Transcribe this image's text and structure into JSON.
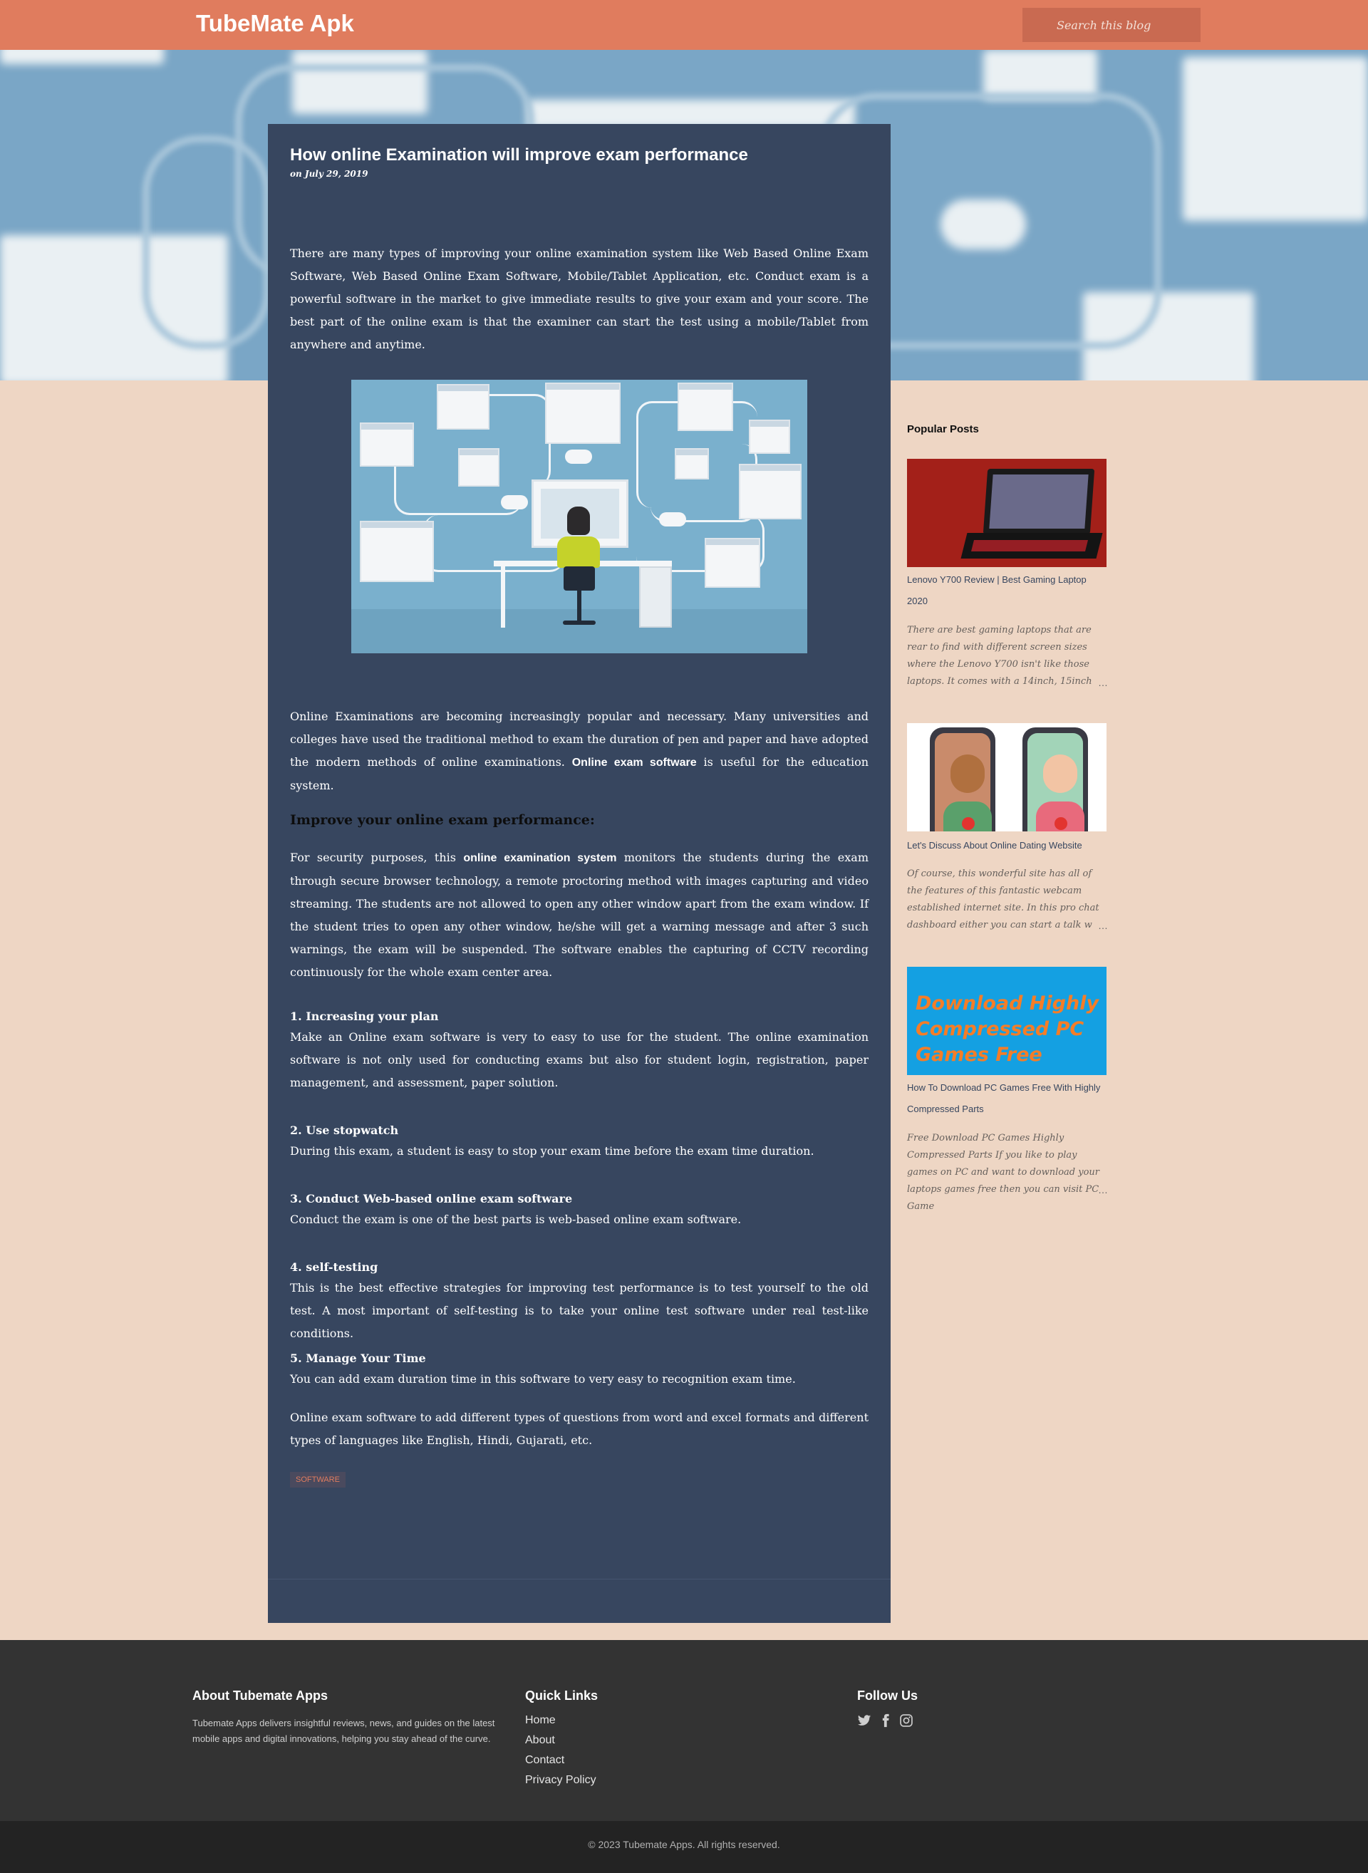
{
  "header": {
    "site_title": "TubeMate Apk",
    "search_placeholder": "Search this blog"
  },
  "post": {
    "title": "How online Examination will improve exam performance",
    "date": "on July 29, 2019",
    "intro": "There are many types of improving your online examination system like Web Based Online Exam Software, Web Based Online Exam Software, Mobile/Tablet Application, etc. Conduct exam is a powerful software in the market to give immediate results to give your exam and your score. The best part of the online exam is that the examiner can start the test using a mobile/Tablet from anywhere and anytime.",
    "para2_before": "Online Examinations are becoming increasingly popular and necessary. Many universities and colleges have used the traditional method to exam the duration of pen and paper and have adopted the modern methods of online examinations. ",
    "para2_bold": "Online exam software",
    "para2_after": " is useful for the education system.",
    "subheading": "Improve your online exam performance:",
    "security_before": "For security purposes, this ",
    "security_bold": "online examination system",
    "security_after": " monitors the students during the exam through secure browser technology, a remote proctoring method with images capturing and video streaming. The students are not allowed to open any other window apart from the exam window. If the student tries to open any other window, he/she will get a warning message and after 3 such warnings, the exam will be suspended. The software enables the capturing of CCTV recording continuously for the whole exam center area.",
    "items": [
      {
        "title": "1. Increasing your plan",
        "text": "Make an Online exam software is very to easy to use for the student. The online examination software is not only used for conducting exams but also for student login, registration, paper management, and assessment, paper solution."
      },
      {
        "title": "2. Use stopwatch",
        "text": "During this exam, a student is easy to stop your exam time before the exam time duration."
      },
      {
        "title": "3. Conduct  Web-based online  exam software",
        "text": "Conduct the exam is one of the best parts is web-based online exam software."
      },
      {
        "title": "4. self-testing",
        "text": "This is the best effective strategies for improving test performance is to test yourself to the old test. A most important of self-testing is to take your online test software under real test-like conditions."
      },
      {
        "title": "5. Manage Your Time",
        "text": "You can add exam duration time in this software to very easy to recognition exam time."
      }
    ],
    "closing": "Online exam software to add different types of questions from word and excel formats and different types of languages like English, Hindi, Gujarati, etc.",
    "tag": "SOFTWARE"
  },
  "sidebar": {
    "title": "Popular Posts",
    "posts": [
      {
        "title": "Lenovo Y700 Review | Best Gaming Laptop 2020",
        "snippet": "There are best gaming laptops that are rear to find with different screen sizes where the Lenovo Y700 isn't like those laptops. It comes with a 14inch, 15inch",
        "more": "…"
      },
      {
        "title": "Let's Discuss About Online Dating Website",
        "snippet": "Of course, this wonderful site has all of the features of this fantastic webcam established internet site. In this pro chat dashboard either you can start a talk w",
        "more": "…"
      },
      {
        "title": "How To Download PC Games Free With Highly Compressed Parts",
        "snippet": "Free Download PC Games Highly Compressed Parts If you like to play games on PC and want to download your laptops games free then you can visit PC Game",
        "more": "…",
        "thumb_text": "Download Highly Compressed PC Games Free"
      }
    ]
  },
  "footer": {
    "about_title": "About Tubemate Apps",
    "about_text": "Tubemate Apps delivers insightful reviews, news, and guides on the latest mobile apps and digital innovations, helping you stay ahead of the curve.",
    "links_title": "Quick Links",
    "links": [
      "Home",
      "About",
      "Contact",
      "Privacy Policy"
    ],
    "follow_title": "Follow Us",
    "social_icons": [
      "twitter-icon",
      "facebook-icon",
      "instagram-icon"
    ],
    "copyright": "© 2023 Tubemate Apps. All rights reserved."
  },
  "colors": {
    "header": "#e07c5e",
    "post_bg": "#37465f",
    "page_bg": "#eed6c4",
    "footer": "#333333",
    "footer_bottom": "#232323",
    "tag_text": "#e07c5e"
  }
}
